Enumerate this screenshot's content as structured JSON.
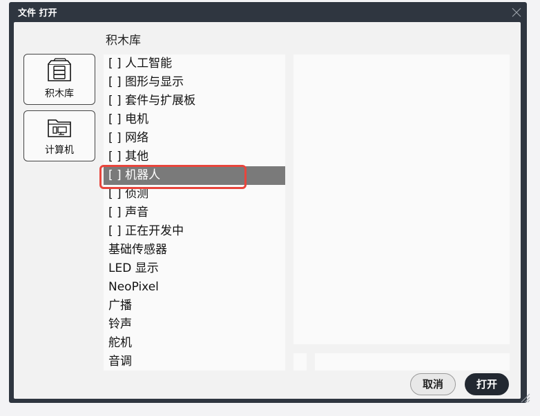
{
  "dialog": {
    "title": "文件 打开",
    "current_folder": "积木库",
    "places": [
      {
        "label": "积木库",
        "icon": "block-library-icon"
      },
      {
        "label": "计算机",
        "icon": "computer-folder-icon"
      }
    ],
    "files": [
      "[ ] 人工智能",
      "[ ] 图形与显示",
      "[ ] 套件与扩展板",
      "[ ] 电机",
      "[ ] 网络",
      "[ ] 其他",
      "[ ] 机器人",
      "[ ] 侦测",
      "[ ] 声音",
      "[ ] 正在开发中",
      "基础传感器",
      "LED 显示",
      "NeoPixel",
      "广播",
      "铃声",
      "舵机",
      "音调"
    ],
    "selected_file": "[ ] 机器人",
    "buttons": {
      "cancel": "取消",
      "open": "打开"
    }
  },
  "colors": {
    "frame": "#2f3640",
    "selection": "#7a7a7a",
    "highlight": "#e8453c",
    "open_button": "#222831"
  }
}
